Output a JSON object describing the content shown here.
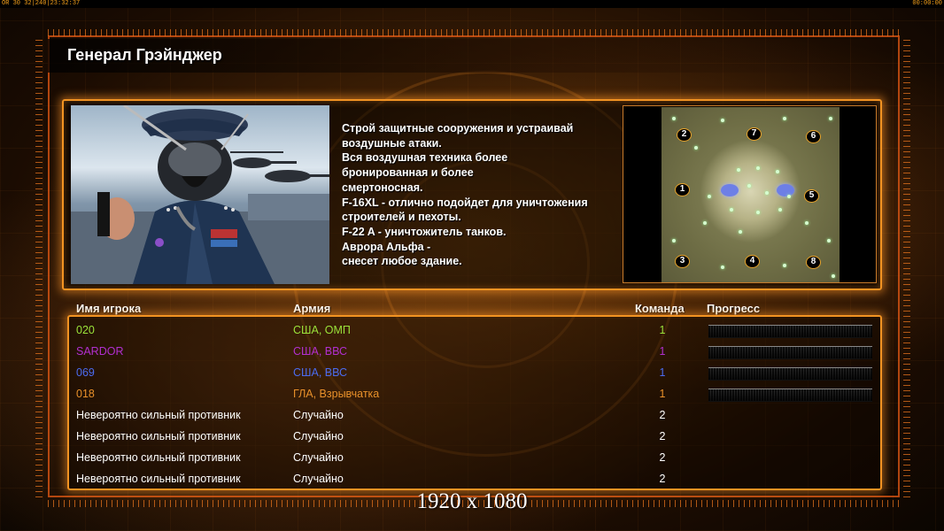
{
  "topbar": {
    "left": "ОR 30 32|240|23:32:37",
    "right": "00:00:00"
  },
  "title": "Генерал Грэйнджер",
  "description": "Строй защитные сооружения и устраивай\n воздушные атаки.\nВся воздушная техника более\n бронированная и более\nсмертоносная.\nF-16XL - отлично подойдет для уничтожения\n строителей и пехоты.\nF-22 A - уничтожитель танков.\nАврора Альфа -\nснесет любое здание.",
  "map": {
    "spawns": [
      "2",
      "7",
      "6",
      "1",
      "5",
      "3",
      "4",
      "8"
    ]
  },
  "table": {
    "headers": {
      "name": "Имя игрока",
      "army": "Армия",
      "team": "Команда",
      "progress": "Прогресс"
    },
    "rows": [
      {
        "name": "020",
        "army": "США, ОМП",
        "team": "1",
        "color": "#9be23a",
        "bar": true
      },
      {
        "name": "SARDOR",
        "army": "США, ВВС",
        "team": "1",
        "color": "#b22fd0",
        "bar": true
      },
      {
        "name": "069",
        "army": "США, ВВС",
        "team": "1",
        "color": "#4b6cf0",
        "bar": true
      },
      {
        "name": "018",
        "army": "ГЛА, Взрывчатка",
        "team": "1",
        "color": "#e8902a",
        "bar": true
      },
      {
        "name": "Невероятно сильный противник",
        "army": "Случайно",
        "team": "2",
        "color": "#ffffff",
        "bar": false
      },
      {
        "name": "Невероятно сильный противник",
        "army": "Случайно",
        "team": "2",
        "color": "#ffffff",
        "bar": false
      },
      {
        "name": "Невероятно сильный противник",
        "army": "Случайно",
        "team": "2",
        "color": "#ffffff",
        "bar": false
      },
      {
        "name": "Невероятно сильный противник",
        "army": "Случайно",
        "team": "2",
        "color": "#ffffff",
        "bar": false
      }
    ]
  },
  "resolution_label": "1920 x 1080"
}
